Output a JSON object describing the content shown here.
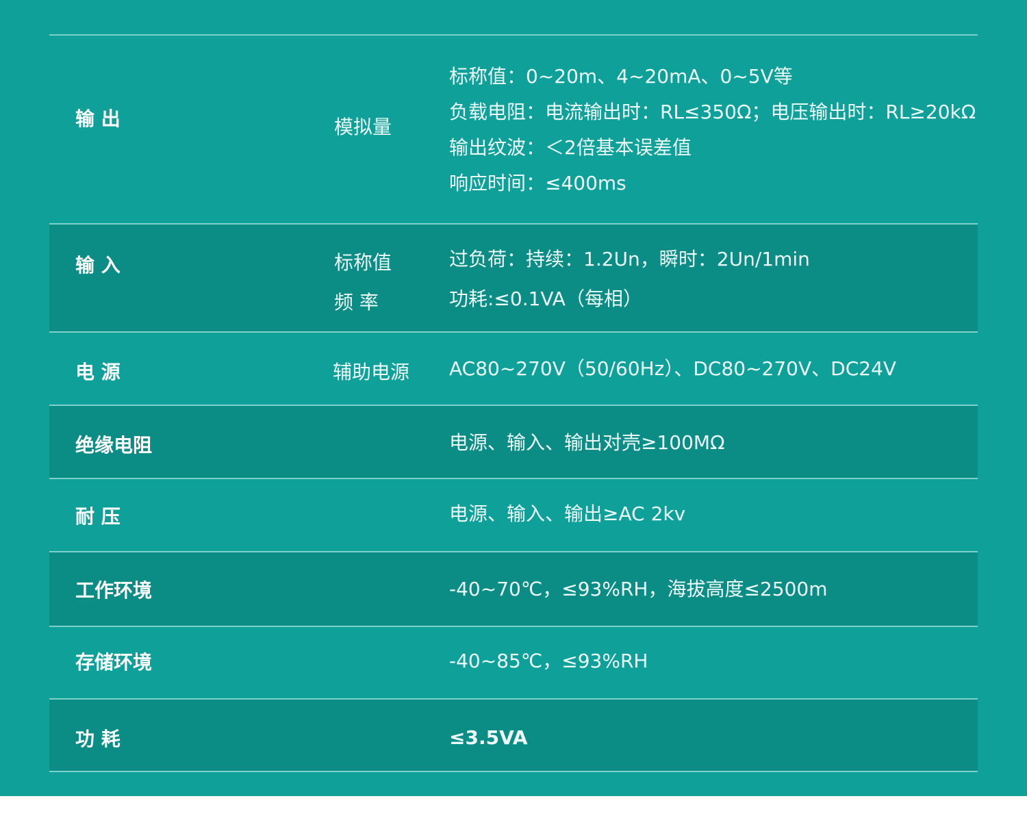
{
  "rows": [
    {
      "label": "输    出",
      "sub": [
        "模拟量"
      ],
      "values": [
        "标称值：0~20m、4~20mA、0~5V等",
        "负载电阻：电流输出时：RL≤350Ω；电压输出时：RL≥20kΩ",
        "输出纹波：＜2倍基本误差值",
        "响应时间：≤400ms"
      ]
    },
    {
      "label": "输    入",
      "sub": [
        "标称值",
        "频    率"
      ],
      "values": [
        "过负荷：持续：1.2Un，瞬时：2Un/1min",
        "功耗:≤0.1VA（每相）"
      ]
    },
    {
      "label": "电    源",
      "sub": [
        "辅助电源"
      ],
      "values": [
        "AC80~270V（50/60Hz）、DC80~270V、DC24V"
      ]
    },
    {
      "label": "绝缘电阻",
      "sub": [],
      "values": [
        "电源、输入、输出对壳≥100MΩ"
      ]
    },
    {
      "label": "耐    压",
      "sub": [],
      "values": [
        "电源、输入、输出≥AC 2kv"
      ]
    },
    {
      "label": "工作环境",
      "sub": [],
      "values": [
        "-40~70℃，≤93%RH，海拔高度≤2500m"
      ]
    },
    {
      "label": "存储环境",
      "sub": [],
      "values": [
        "-40~85℃，≤93%RH"
      ]
    },
    {
      "label": "功    耗",
      "sub": [],
      "values": [
        "≤3.5VA"
      ]
    }
  ],
  "colors": {
    "background": "#0fa199",
    "row_alt": "#0b8d86",
    "divider": "#7fd2cb"
  }
}
